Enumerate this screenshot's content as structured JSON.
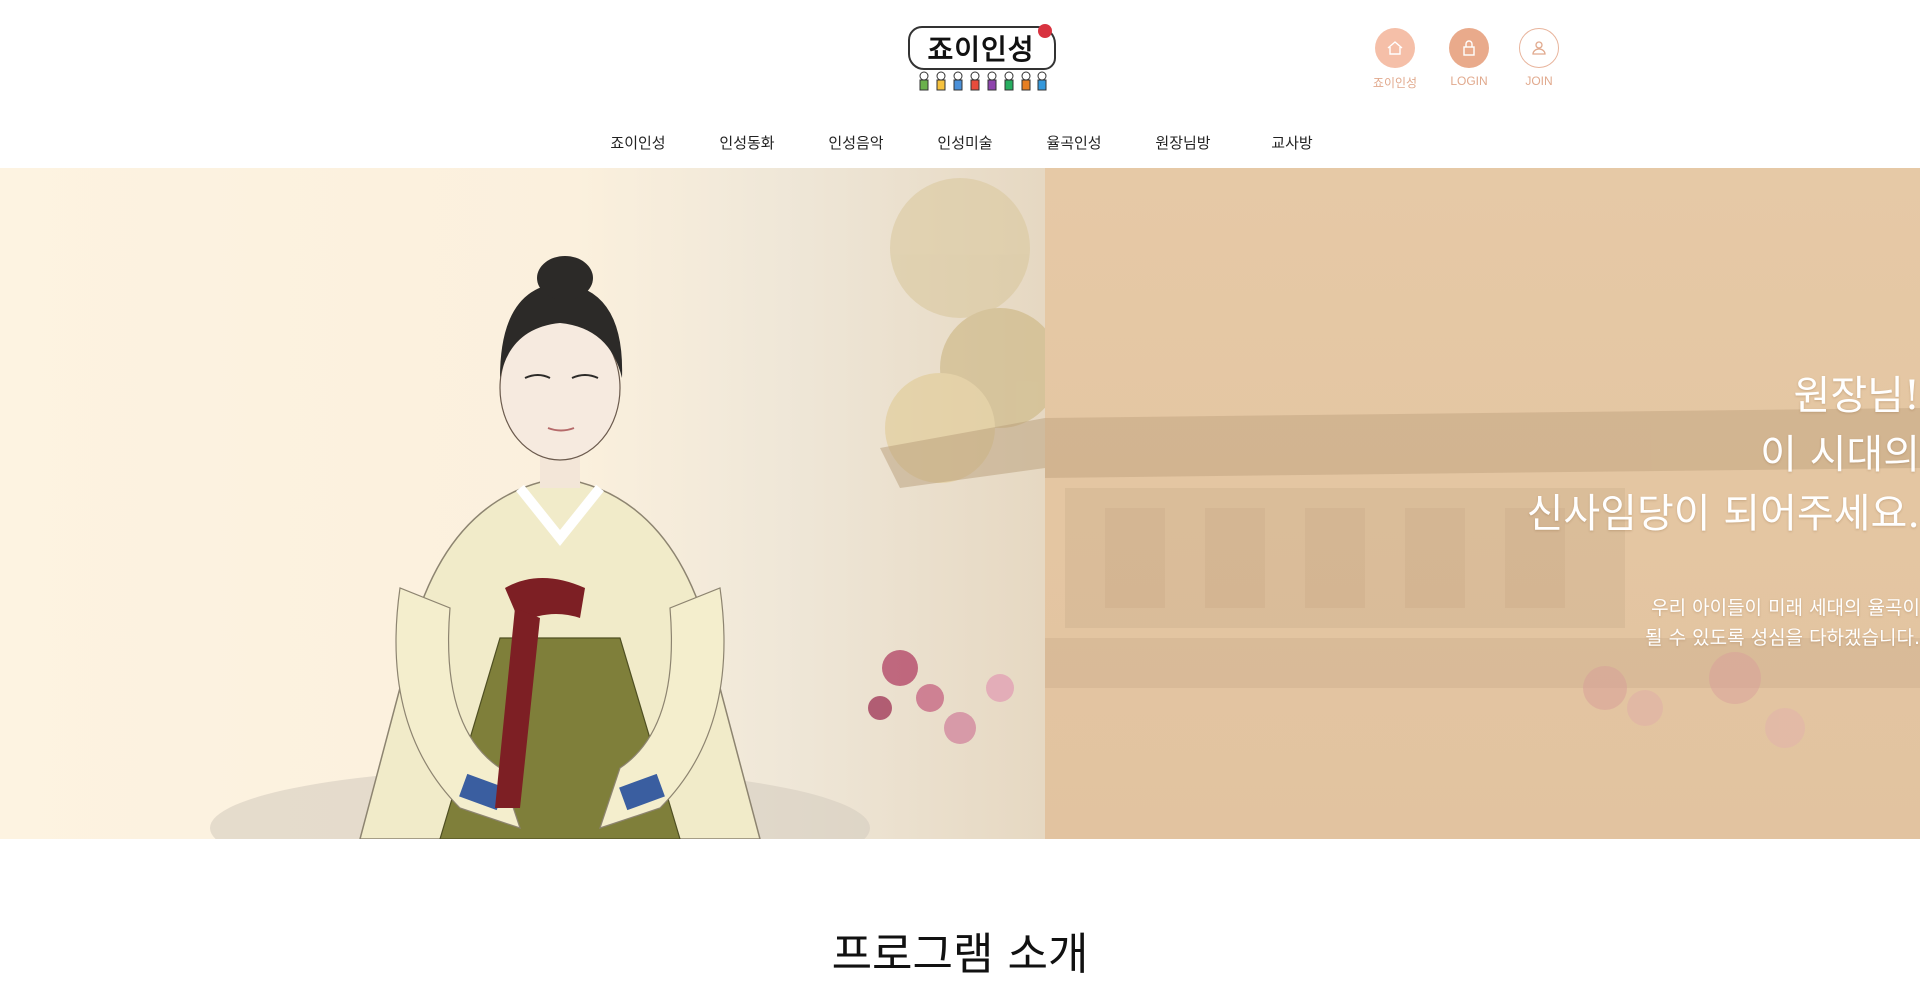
{
  "brand": {
    "logo_text": "죠이인성"
  },
  "util_links": [
    {
      "label": "죠이인성",
      "icon": "home-icon"
    },
    {
      "label": "LOGIN",
      "icon": "lock-icon"
    },
    {
      "label": "JOIN",
      "icon": "user-icon"
    }
  ],
  "nav": {
    "items": [
      {
        "label": "죠이인성"
      },
      {
        "label": "인성동화"
      },
      {
        "label": "인성음악"
      },
      {
        "label": "인성미술"
      },
      {
        "label": "율곡인성"
      },
      {
        "label": "원장님방"
      },
      {
        "label": "교사방"
      }
    ]
  },
  "hero": {
    "headline": [
      "원장님!",
      "이 시대의",
      "신사임당이 되어주세요."
    ],
    "subtext": [
      "우리 아이들이 미래 세대의 율곡이",
      "될 수 있도록 성심을 다하겠습니다."
    ]
  },
  "section": {
    "title": "프로그램 소개"
  },
  "colors": {
    "accent": "#f3b9a0",
    "accent_dark": "#e8a98a",
    "hero_right": "#e4c6a2"
  }
}
